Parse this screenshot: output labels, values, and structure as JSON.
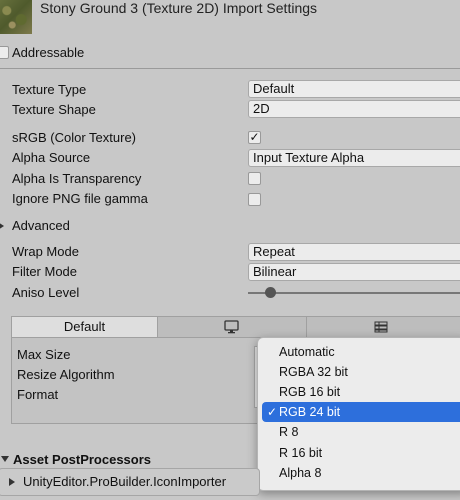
{
  "header": {
    "title": "Stony Ground 3 (Texture 2D) Import Settings"
  },
  "addressable": {
    "label": "Addressable",
    "checked": false
  },
  "properties": {
    "texture_type": {
      "label": "Texture Type",
      "value": "Default"
    },
    "texture_shape": {
      "label": "Texture Shape",
      "value": "2D"
    },
    "srgb": {
      "label": "sRGB (Color Texture)",
      "checked": true,
      "mark": "✓"
    },
    "alpha_source": {
      "label": "Alpha Source",
      "value": "Input Texture Alpha"
    },
    "alpha_is_transparency": {
      "label": "Alpha Is Transparency",
      "checked": false
    },
    "ignore_png_gamma": {
      "label": "Ignore PNG file gamma",
      "checked": false
    }
  },
  "advanced": {
    "label": "Advanced"
  },
  "wrap_mode": {
    "label": "Wrap Mode",
    "value": "Repeat"
  },
  "filter_mode": {
    "label": "Filter Mode",
    "value": "Bilinear"
  },
  "aniso_level": {
    "label": "Aniso Level",
    "value": 1
  },
  "platform": {
    "tabs": [
      {
        "label": "Default",
        "icon": null,
        "active": true
      },
      {
        "label": "",
        "icon": "monitor-icon",
        "active": false
      },
      {
        "label": "",
        "icon": "grid-icon",
        "active": false
      }
    ],
    "max_size": {
      "label": "Max Size"
    },
    "resize_algorithm": {
      "label": "Resize Algorithm"
    },
    "format": {
      "label": "Format"
    }
  },
  "format_dropdown": {
    "options": [
      "Automatic",
      "RGBA 32 bit",
      "RGB 16 bit",
      "RGB 24 bit",
      "R 8",
      "R 16 bit",
      "Alpha 8"
    ],
    "selected": "RGB 24 bit",
    "check_mark": "✓"
  },
  "postprocessors": {
    "title": "Asset PostProcessors",
    "item": "UnityEditor.ProBuilder.IconImporter"
  }
}
